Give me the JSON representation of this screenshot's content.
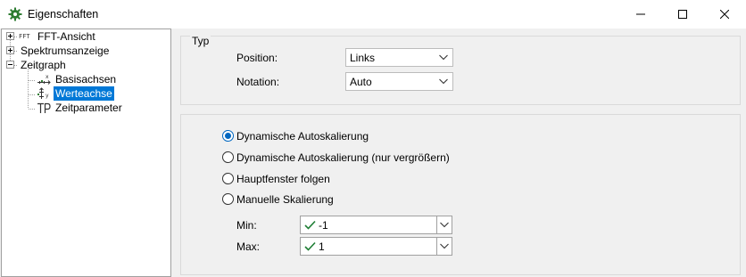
{
  "window": {
    "title": "Eigenschaften",
    "icon": "gear-icon",
    "accent": "#0078d7"
  },
  "tree": {
    "items": [
      {
        "label": "FFT-Ansicht",
        "icon": "fft-icon",
        "expander": "+"
      },
      {
        "label": "Spektrumsanzeige",
        "icon": "none",
        "expander": "+"
      },
      {
        "label": "Zeitgraph",
        "icon": "none",
        "expander": "-"
      },
      {
        "label": "Basisachsen",
        "icon": "base-axes-icon"
      },
      {
        "label": "Werteachse",
        "icon": "value-axis-icon",
        "selected": true
      },
      {
        "label": "Zeitparameter",
        "icon": "time-parameter-icon"
      }
    ],
    "fft_icon_text": "FFT"
  },
  "typ": {
    "title": "Typ",
    "position_label": "Position:",
    "position_value": "Links",
    "notation_label": "Notation:",
    "notation_value": "Auto"
  },
  "scaling": {
    "options": [
      {
        "label": "Dynamische Autoskalierung",
        "checked": true
      },
      {
        "label": "Dynamische Autoskalierung (nur vergrößern)",
        "checked": false
      },
      {
        "label": "Hauptfenster folgen",
        "checked": false
      },
      {
        "label": "Manuelle Skalierung",
        "checked": false
      }
    ],
    "min_label": "Min:",
    "min_value": "-1",
    "max_label": "Max:",
    "max_value": "1",
    "valid_color": "#1e7e34"
  }
}
